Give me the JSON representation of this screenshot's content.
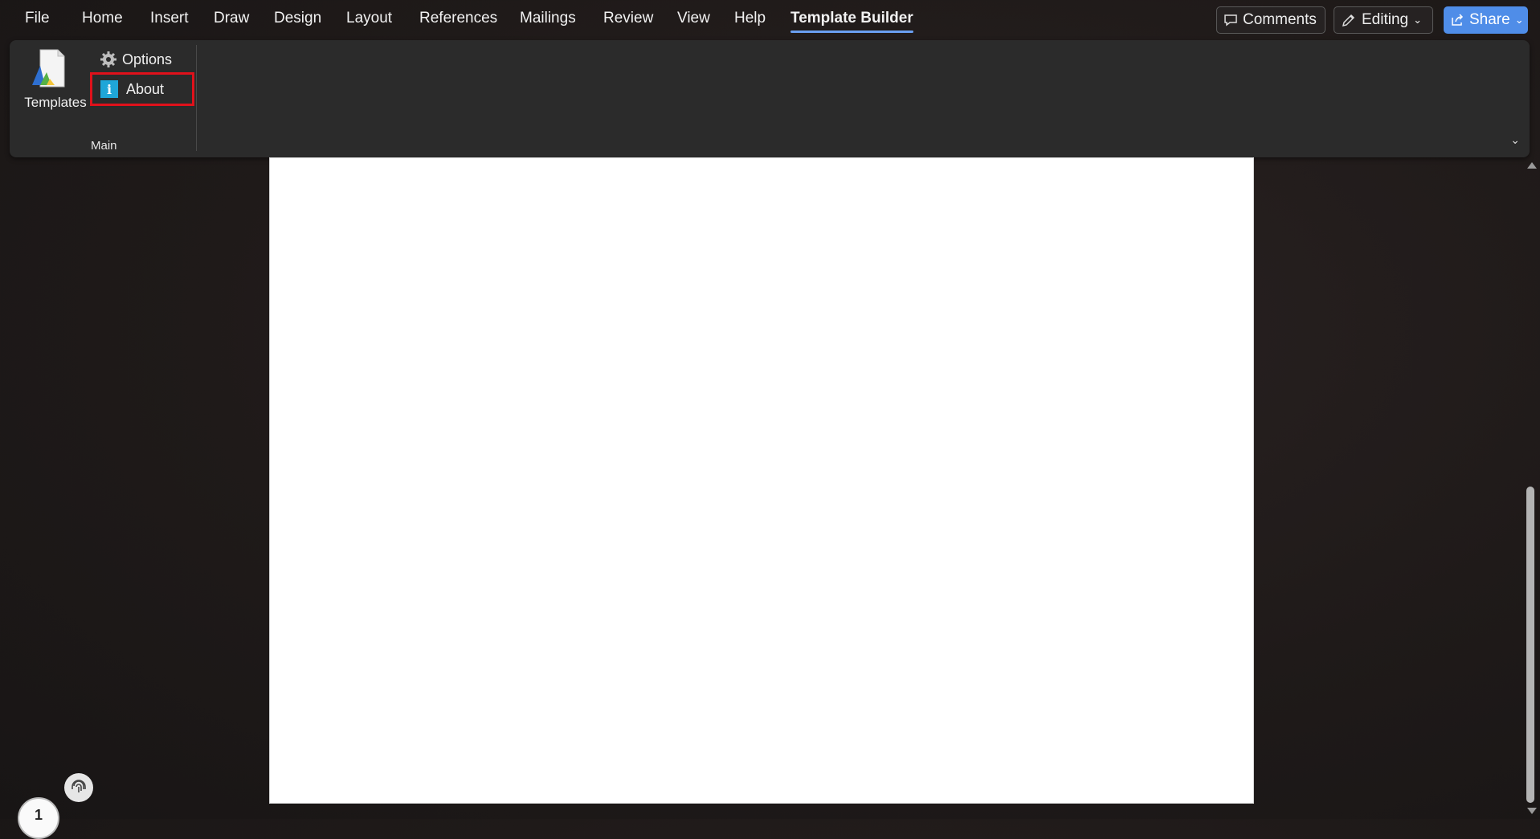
{
  "menu": {
    "tabs": [
      "File",
      "Home",
      "Insert",
      "Draw",
      "Design",
      "Layout",
      "References",
      "Mailings",
      "Review",
      "View",
      "Help",
      "Template Builder"
    ],
    "active_tab": "Template Builder"
  },
  "top_right": {
    "comments_label": "Comments",
    "editing_label": "Editing",
    "share_label": "Share"
  },
  "ribbon": {
    "templates_label": "Templates",
    "options_label": "Options",
    "about_label": "About",
    "group_label": "Main"
  },
  "page_counter": "1",
  "colors": {
    "accent": "#4f8de8",
    "highlight_border": "#e0111b",
    "info_icon": "#1fa6d8"
  }
}
